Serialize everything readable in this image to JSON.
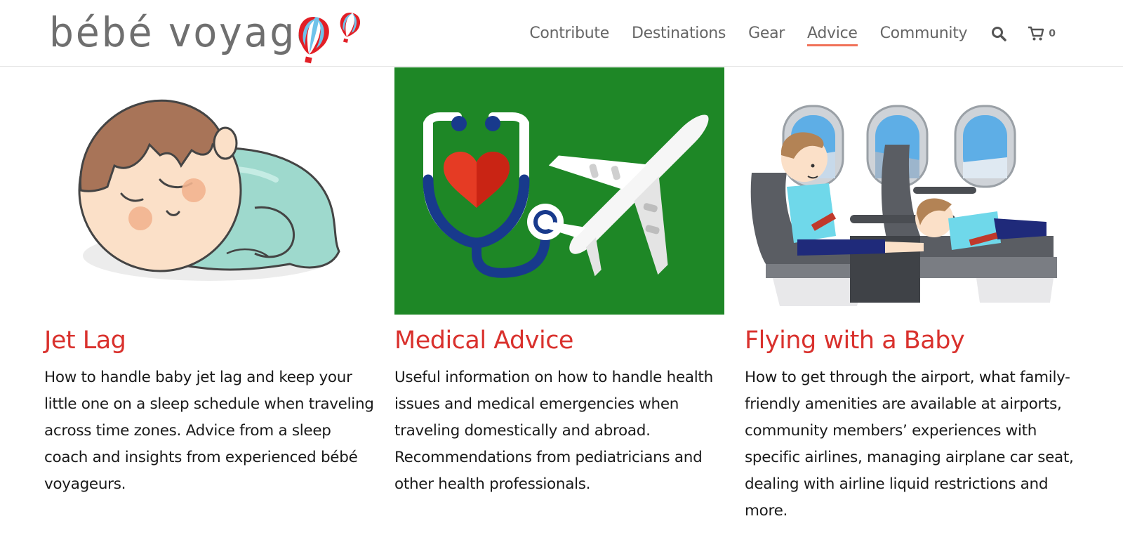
{
  "logo": {
    "text": "bébé voyage"
  },
  "nav": {
    "items": [
      {
        "label": "Contribute"
      },
      {
        "label": "Destinations"
      },
      {
        "label": "Gear"
      },
      {
        "label": "Advice"
      },
      {
        "label": "Community"
      }
    ],
    "active": "Advice",
    "cart_count": "0",
    "accent_color": "#f07158"
  },
  "cards": [
    {
      "title": "Jet Lag",
      "text": "How to handle baby jet lag and keep your little one on a sleep schedule when traveling across time zones. Advice from a sleep coach and insights from experienced bébé voyageurs.",
      "image": "sleeping-baby-illustration"
    },
    {
      "title": "Medical Advice",
      "text": "Useful information on how to handle health issues and medical emergencies when traveling domestically and abroad. Recommendations from pediatricians and other health professionals.",
      "image": "stethoscope-and-airplane-illustration"
    },
    {
      "title": "Flying with a Baby",
      "text": "How to get through the airport, what family-friendly amenities are available at airports, community members’ experiences with specific airlines, managing airplane car seat, dealing with airline liquid restrictions and more.",
      "image": "children-in-airplane-seats-illustration"
    }
  ],
  "colors": {
    "title": "#d9312d",
    "medical_bg": "#1e8726"
  }
}
